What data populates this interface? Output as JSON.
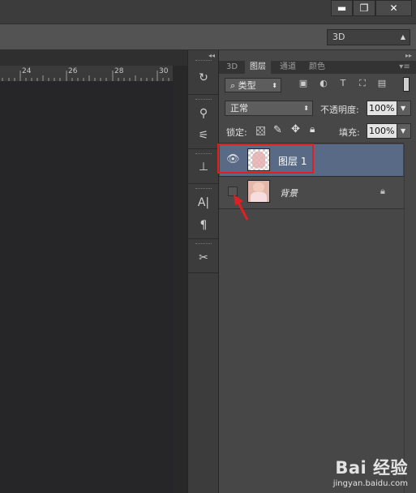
{
  "window": {
    "minimize": "▬",
    "restore": "❐",
    "close": "✕"
  },
  "workspace": {
    "selected": "3D"
  },
  "ruler": {
    "ticks": [
      "24",
      "26",
      "28",
      "30"
    ]
  },
  "panel_collapse": "◂◂",
  "panel_expand": "▸▸",
  "tabs": [
    {
      "label": "3D"
    },
    {
      "label": "图层"
    },
    {
      "label": "通道"
    },
    {
      "label": "颜色"
    }
  ],
  "panel_menu": "▾≡",
  "filter": {
    "label": "类型"
  },
  "blend": {
    "mode": "正常",
    "opacity_label": "不透明度:",
    "opacity": "100%"
  },
  "lock": {
    "label": "锁定:",
    "fill_label": "填充:",
    "fill": "100%"
  },
  "layers": [
    {
      "name": "图层 1",
      "visible": true,
      "selected": true
    },
    {
      "name": "背景",
      "visible": false,
      "locked": true
    }
  ],
  "watermark": {
    "brand": "Bai 经验",
    "url": "jingyan.baidu.com"
  },
  "colors": {
    "accent": "#e02020",
    "selected_row": "#586a86"
  }
}
